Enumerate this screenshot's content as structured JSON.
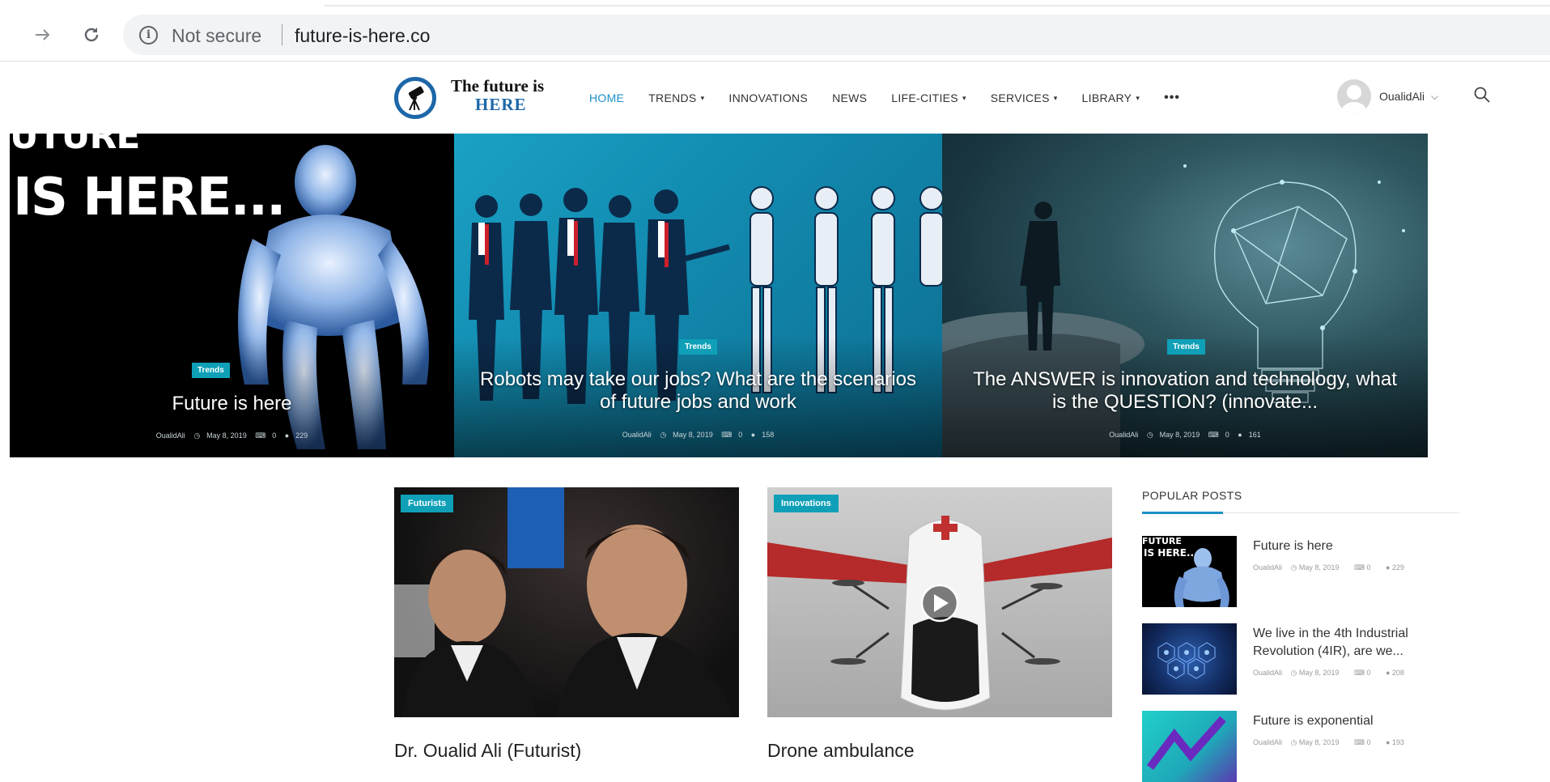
{
  "browser": {
    "url": "future-is-here.co",
    "security_label": "Not secure",
    "info_icon": "info-icon",
    "forward_icon": "arrow-right-icon",
    "reload_icon": "reload-icon"
  },
  "site": {
    "logo_line1": "The future is",
    "logo_line2": "HERE",
    "menu": [
      {
        "label": "HOME",
        "active": true,
        "dropdown": false
      },
      {
        "label": "TRENDS",
        "active": false,
        "dropdown": true
      },
      {
        "label": "INNOVATIONS",
        "active": false,
        "dropdown": false
      },
      {
        "label": "NEWS",
        "active": false,
        "dropdown": false
      },
      {
        "label": "LIFE-CITIES",
        "active": false,
        "dropdown": true
      },
      {
        "label": "SERVICES",
        "active": false,
        "dropdown": true
      },
      {
        "label": "LIBRARY",
        "active": false,
        "dropdown": true
      }
    ],
    "more_label": "•••",
    "user_name": "OualidAli",
    "caret": "▾",
    "chevron": "⌵",
    "accent_color": "#1d8fc9",
    "badge_color": "#0fa0b8"
  },
  "hero": [
    {
      "badge": "Trends",
      "title_line1": "Future is here",
      "title_line2": "",
      "author": "OualidAli",
      "date": "May 8, 2019",
      "comments": "0",
      "views": "229",
      "image_text_1": "UTURE",
      "image_text_2": "IS HERE..."
    },
    {
      "badge": "Trends",
      "title_line1": "Robots may take our jobs? What are the scenarios",
      "title_line2": "of future jobs and work",
      "author": "OualidAli",
      "date": "May 8, 2019",
      "comments": "0",
      "views": "158"
    },
    {
      "badge": "Trends",
      "title_line1": "The ANSWER is innovation and technology, what",
      "title_line2": "is the QUESTION? (innovate...",
      "author": "OualidAli",
      "date": "May 8, 2019",
      "comments": "0",
      "views": "161"
    }
  ],
  "posts": [
    {
      "badge": "Futurists",
      "title": "Dr. Oualid Ali (Futurist)"
    },
    {
      "badge": "Innovations",
      "title": "Drone ambulance"
    }
  ],
  "sidebar": {
    "title": "POPULAR POSTS",
    "items": [
      {
        "title": "Future is here",
        "author": "OualidAli",
        "date": "May 8, 2019",
        "comments": "0",
        "views": "229",
        "thumb_text_1": "FUTURE",
        "thumb_text_2": "IS HERE..."
      },
      {
        "title": "We live in the 4th Industrial Revolution (4IR), are we...",
        "author": "OualidAli",
        "date": "May 8, 2019",
        "comments": "0",
        "views": "208"
      },
      {
        "title": "Future is exponential",
        "author": "OualidAli",
        "date": "May 8, 2019",
        "comments": "0",
        "views": "193"
      }
    ]
  },
  "meta_icons": {
    "clock": "◷",
    "comment": "🗨",
    "eye": "👁"
  }
}
